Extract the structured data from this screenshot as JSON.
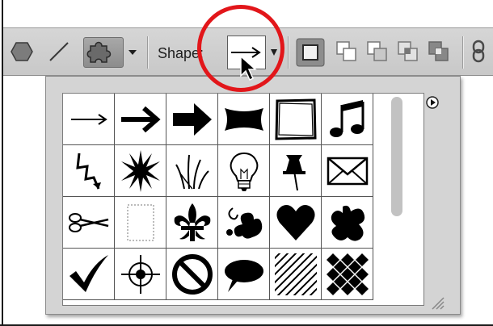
{
  "options_bar": {
    "shape_label": "Shape:",
    "tools": [
      "polygon-tool",
      "line-tool",
      "custom-shape-tool"
    ],
    "path_operations": [
      "new-layer",
      "combine",
      "subtract",
      "intersect",
      "exclude"
    ]
  },
  "shape_picker": {
    "selected_shape": "arrow-thin",
    "icons": [
      [
        "arrow-thin",
        "arrow-medium",
        "arrow-bold",
        "banner",
        "frame",
        "music-note"
      ],
      [
        "lightning",
        "starburst",
        "grass",
        "lightbulb",
        "pushpin",
        "envelope"
      ],
      [
        "scissors",
        "stamp",
        "fleur-de-lis",
        "ornament",
        "heart",
        "splat"
      ],
      [
        "checkmark",
        "target",
        "no-sign",
        "speech-bubble",
        "diagonal-lines",
        "checkerboard"
      ]
    ]
  },
  "colors": {
    "highlight": "#e2161a",
    "toolbar_bg": "#cfcfcf",
    "panel_bg": "#d4d4d4"
  }
}
